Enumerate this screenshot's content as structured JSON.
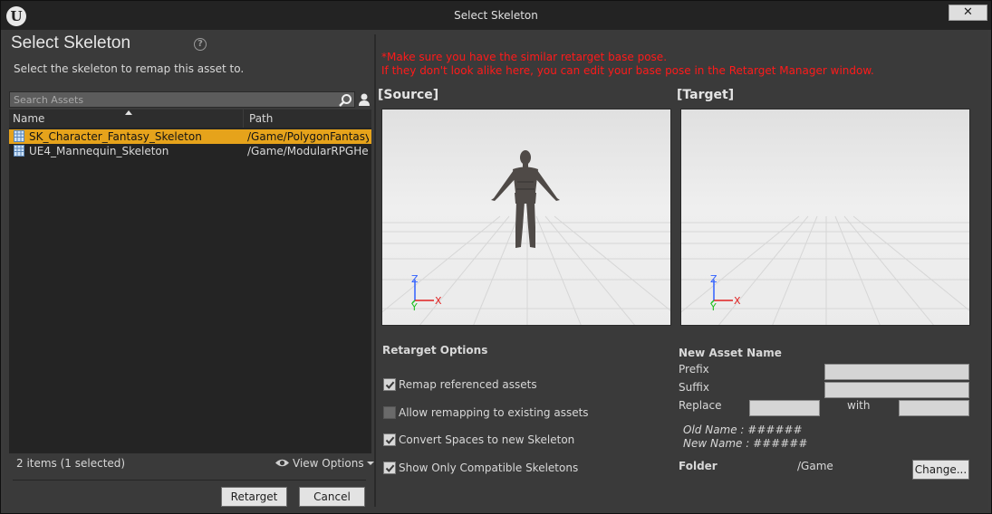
{
  "window": {
    "title": "Select Skeleton",
    "close_glyph": "✕"
  },
  "left": {
    "heading": "Select Skeleton",
    "subtext": "Select the skeleton to remap this asset to.",
    "search_placeholder": "Search Assets",
    "columns": {
      "name": "Name",
      "path": "Path"
    },
    "rows": [
      {
        "name": "SK_Character_Fantasy_Skeleton",
        "path": "/Game/PolygonFantasy",
        "selected": true
      },
      {
        "name": "UE4_Mannequin_Skeleton",
        "path": "/Game/ModularRPGHer",
        "selected": false
      }
    ],
    "item_count": "2 items (1 selected)",
    "view_options": "View Options",
    "retarget_button": "Retarget",
    "cancel_button": "Cancel"
  },
  "right": {
    "warning_line1": "*Make sure you have the similar retarget base pose.",
    "warning_line2": "If they don't look alike here, you can edit your base pose in the Retarget Manager window.",
    "source_label": "[Source]",
    "target_label": "[Target]",
    "axis": {
      "z": "Z",
      "x": "X",
      "y": "Y"
    },
    "retarget_options": {
      "title": "Retarget Options",
      "items": [
        {
          "label": "Remap referenced assets",
          "checked": true
        },
        {
          "label": "Allow remapping to existing assets",
          "checked": false
        },
        {
          "label": "Convert Spaces to new Skeleton",
          "checked": true
        },
        {
          "label": "Show Only Compatible Skeletons",
          "checked": true
        }
      ]
    },
    "new_asset": {
      "title": "New Asset Name",
      "prefix_label": "Prefix",
      "suffix_label": "Suffix",
      "replace_label": "Replace",
      "with_label": "with",
      "prefix_value": "",
      "suffix_value": "",
      "replace_value": "",
      "with_value": "",
      "old_name": "Old Name : ######",
      "new_name": "New Name : ######"
    },
    "folder": {
      "label": "Folder",
      "value": "/Game",
      "change_button": "Change..."
    }
  },
  "colors": {
    "selection": "#e6a31b",
    "warning": "#ff1a1a",
    "axis_x": "#e02020",
    "axis_y": "#20c020",
    "axis_z": "#3060ff"
  },
  "icons": [
    "ue-logo-icon",
    "help-icon",
    "search-icon",
    "user-icon",
    "skeleton-asset-icon",
    "eye-icon",
    "checkmark-icon"
  ]
}
